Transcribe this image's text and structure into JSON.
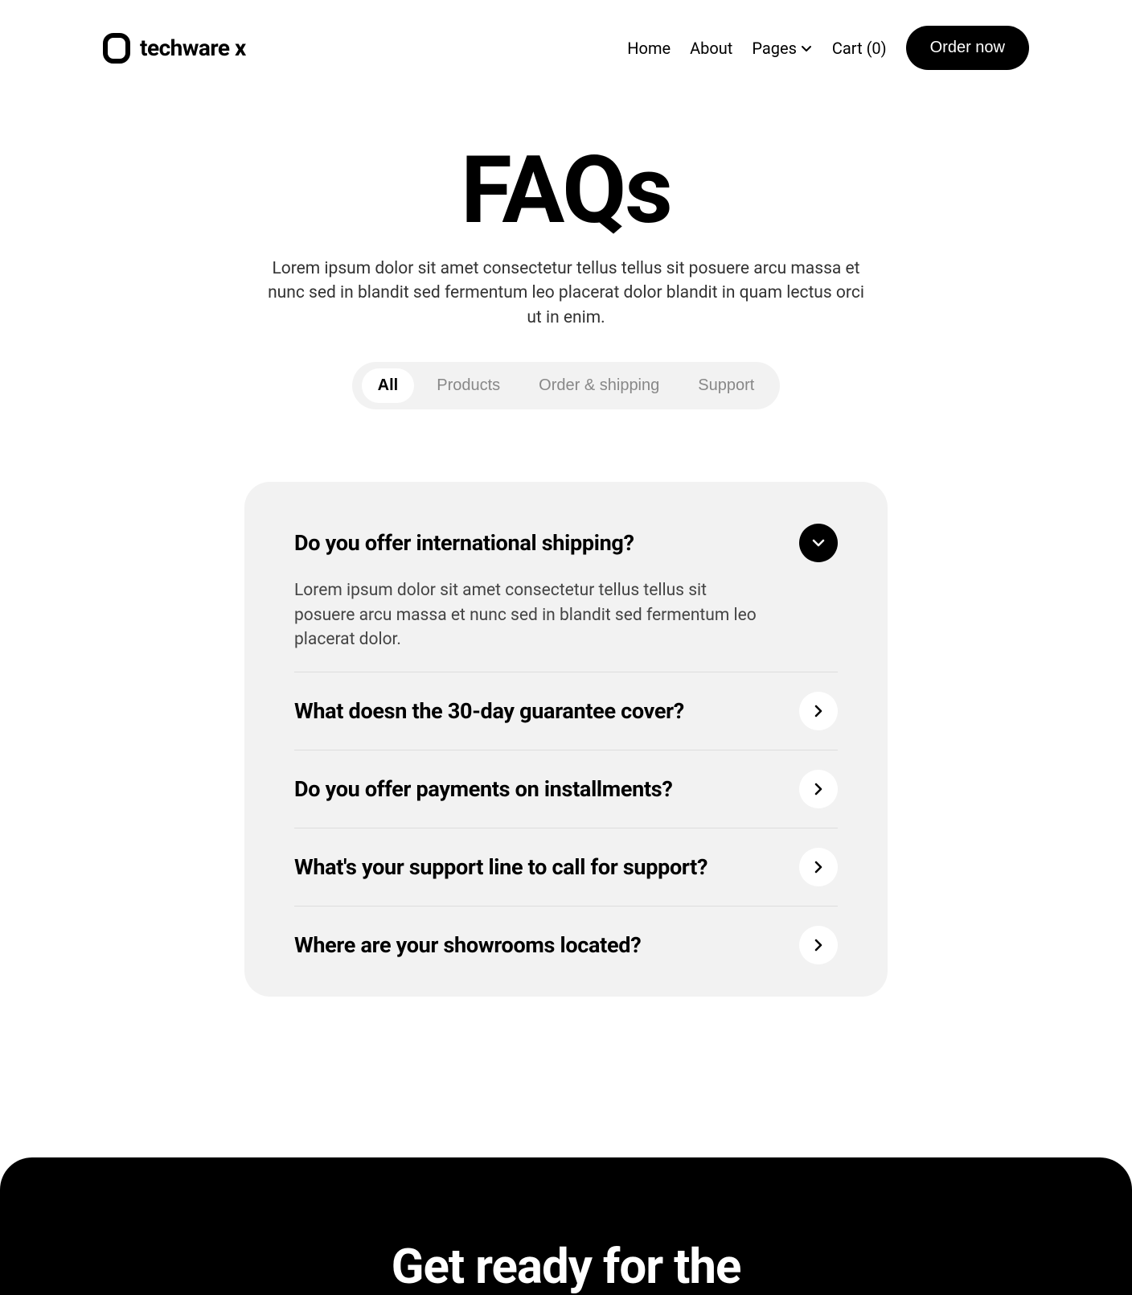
{
  "logo_text": "techware x",
  "nav": {
    "home": "Home",
    "about": "About",
    "pages": "Pages",
    "cart": "Cart (0)",
    "order_btn": "Order now"
  },
  "hero": {
    "title": "FAQs",
    "subtitle": "Lorem ipsum dolor sit amet consectetur tellus tellus sit posuere arcu massa et nunc sed in blandit sed fermentum leo placerat dolor blandit in quam lectus orci ut in enim."
  },
  "tabs": {
    "all": "All",
    "products": "Products",
    "order": "Order & shipping",
    "support": "Support"
  },
  "faqs": {
    "q0": "Do you offer international shipping?",
    "a0": "Lorem ipsum dolor sit amet consectetur tellus tellus sit posuere arcu massa et nunc sed in blandit sed fermentum leo placerat dolor.",
    "q1": "What doesn the 30-day guarantee cover?",
    "q2": "Do you offer payments on installments?",
    "q3": "What's your support line to call for support?",
    "q4": "Where are your showrooms located?"
  },
  "footer": {
    "heading": "Get ready for the"
  }
}
